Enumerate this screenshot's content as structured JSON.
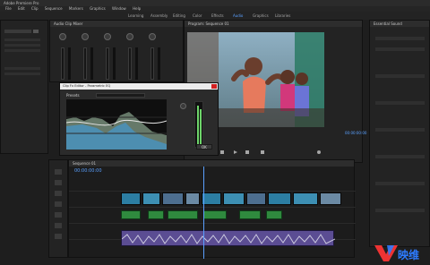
{
  "colors": {
    "background": "#1e1e1e",
    "panel": "#232323",
    "accent_blue": "#5aa0ff",
    "audio_green": "#2f8a3e",
    "meter_green": "#7bd66b",
    "close_red": "#d21f1f"
  },
  "window": {
    "title": "Adobe Premiere Pro"
  },
  "menubar": {
    "items": [
      "File",
      "Edit",
      "Clip",
      "Sequence",
      "Markers",
      "Graphics",
      "Window",
      "Help"
    ]
  },
  "workspaces": {
    "tabs": [
      "Learning",
      "Assembly",
      "Editing",
      "Color",
      "Effects",
      "Audio",
      "Graphics",
      "Libraries"
    ],
    "active": "Audio"
  },
  "audio_clip_mixer": {
    "title": "Audio Clip Mixer"
  },
  "program_monitor": {
    "title": "Program: Sequence 01",
    "timecode": "00:00:00:00"
  },
  "clip_fx_editor": {
    "title": "Clip Fx Editor - Parametric EQ",
    "preset_label": "Presets",
    "button_label": "OK"
  },
  "timeline": {
    "title": "Sequence 01",
    "timecode": "00:00:00:00"
  },
  "right_panel": {
    "title": "Essential Sound"
  },
  "watermark": {
    "text": "映维"
  }
}
